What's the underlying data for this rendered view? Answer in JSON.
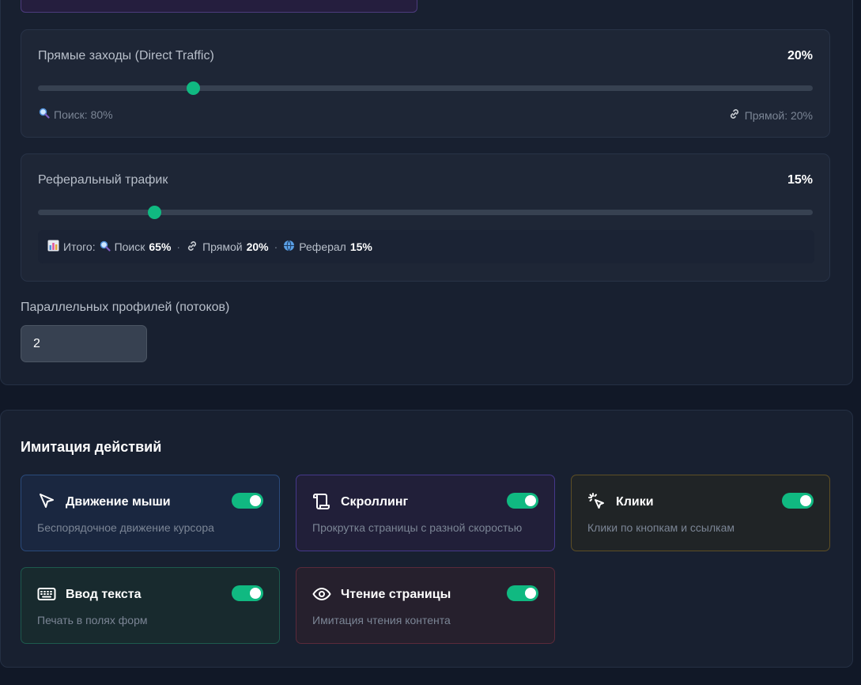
{
  "traffic": {
    "direct": {
      "title": "Прямые заходы (Direct Traffic)",
      "value_label": "20%",
      "value": 20,
      "hint_left": "Поиск: 80%",
      "hint_left_icon": "magnifier-icon",
      "hint_right": "Прямой: 20%",
      "hint_right_icon": "link-icon"
    },
    "referral": {
      "title": "Реферальный трафик",
      "value_label": "15%",
      "value": 15
    },
    "summary": {
      "prefix": "Итого:",
      "search_label": "Поиск",
      "search_value": "65%",
      "direct_label": "Прямой",
      "direct_value": "20%",
      "referral_label": "Реферал",
      "referral_value": "15%",
      "separator": "·"
    }
  },
  "threads": {
    "label": "Параллельных профилей (потоков)",
    "value": "2"
  },
  "actions": {
    "title": "Имитация действий",
    "items": [
      {
        "title": "Движение мыши",
        "desc": "Беспорядочное движение курсора",
        "icon": "cursor-arrow-icon",
        "enabled": true,
        "accent": "#2a4a7b"
      },
      {
        "title": "Скроллинг",
        "desc": "Прокрутка страницы с разной скоростью",
        "icon": "scroll-icon",
        "enabled": true,
        "accent": "#45388a"
      },
      {
        "title": "Клики",
        "desc": "Клики по кнопкам и ссылкам",
        "icon": "pointer-click-icon",
        "enabled": true,
        "accent": "#5e4f25"
      },
      {
        "title": "Ввод текста",
        "desc": "Печать в полях форм",
        "icon": "keyboard-icon",
        "enabled": true,
        "accent": "#1d5a4d"
      },
      {
        "title": "Чтение страницы",
        "desc": "Имитация чтения контента",
        "icon": "eye-icon",
        "enabled": true,
        "accent": "#5a2a3a"
      }
    ]
  },
  "colors": {
    "background": "#111827",
    "card": "#182030",
    "accent_green": "#10b981"
  }
}
